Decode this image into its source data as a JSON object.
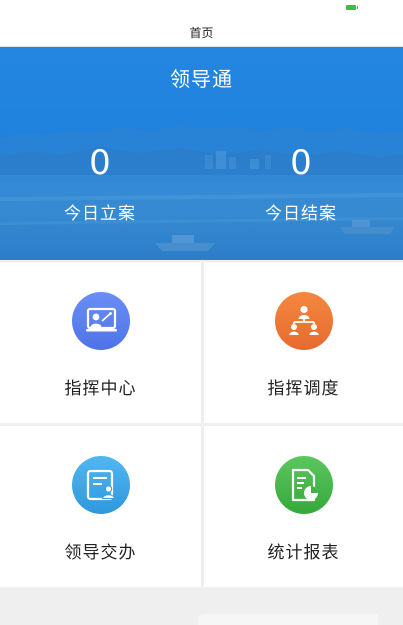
{
  "nav": {
    "title": "首页"
  },
  "hero": {
    "title": "领导通",
    "stats": [
      {
        "value": "0",
        "label": "今日立案"
      },
      {
        "value": "0",
        "label": "今日结案"
      }
    ]
  },
  "grid": {
    "items": [
      {
        "label": "指挥中心",
        "icon": "presentation-icon",
        "color": "#5b7ff0"
      },
      {
        "label": "指挥调度",
        "icon": "org-chart-icon",
        "color": "#f07a3a"
      },
      {
        "label": "领导交办",
        "icon": "assign-doc-icon",
        "color": "#3fa8e8"
      },
      {
        "label": "统计报表",
        "icon": "report-chart-icon",
        "color": "#3eb548"
      }
    ]
  },
  "colors": {
    "hero": "#2486e0",
    "status_battery": "#2ec34a"
  }
}
